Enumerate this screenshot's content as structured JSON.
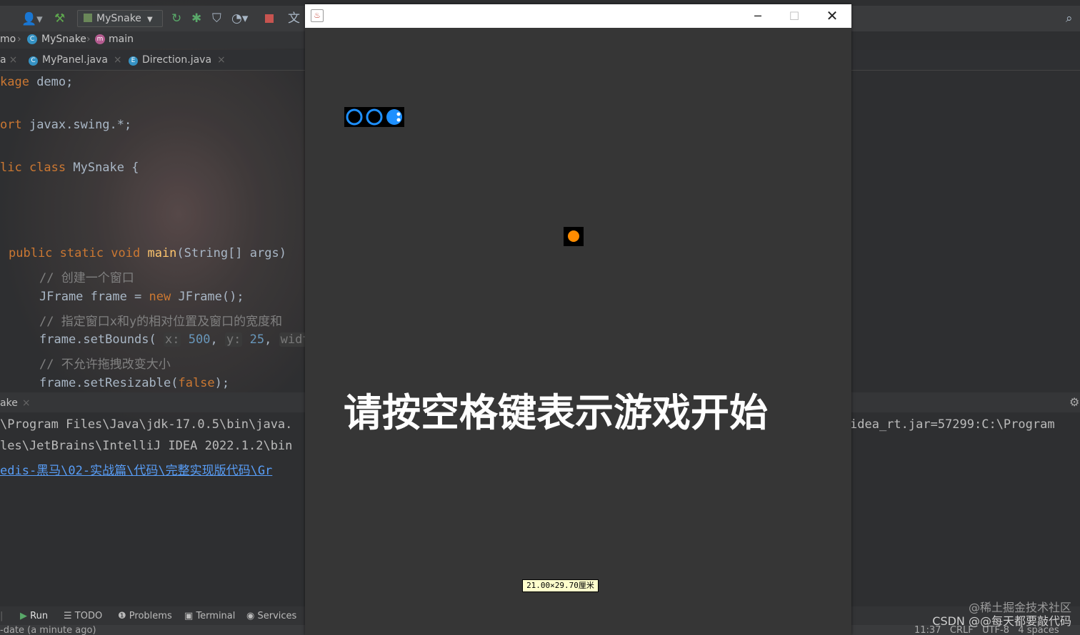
{
  "toolbar": {
    "run_config": "MySnake",
    "icons": [
      "user-icon",
      "build-hammer-icon",
      "rerun-icon",
      "debug-icon",
      "coverage-icon",
      "profile-icon",
      "stop-icon",
      "translate-icon",
      "search-icon"
    ]
  },
  "breadcrumb": {
    "parts": [
      "mo",
      "MySnake",
      "main"
    ]
  },
  "tabs": {
    "first_partial": "a",
    "items": [
      {
        "label": "MyPanel.java",
        "badge": "C"
      },
      {
        "label": "Direction.java",
        "badge": "E"
      }
    ]
  },
  "editor": {
    "line1_kw": "kage",
    "line1_rest": " demo;",
    "line2_kw": "ort",
    "line2_rest": " javax.swing.*;",
    "line3_kw": "lic class",
    "line3_rest": " MySnake {",
    "line4_public": "public static void ",
    "line4_fn": "main",
    "line4_rest": "(String[] args)",
    "comment1": "// 创建一个窗口",
    "line5_a": "JFrame frame = ",
    "line5_kw": "new",
    "line5_b": " JFrame();",
    "comment2": "// 指定窗口x和y的相对位置及窗口的宽度和",
    "line6_a": "frame.setBounds( ",
    "line6_hint_x": "x:",
    "line6_x": "500",
    "line6_hint_y": "y:",
    "line6_y": "25",
    "line6_hint_w": "widt",
    "comment3": "// 不允许拖拽改变大小",
    "line7_a": "frame.setResizable(",
    "line7_kw": "false",
    "line7_b": ");"
  },
  "run_panel": {
    "tab_label": "ake",
    "console_lines": [
      "\\Program Files\\Java\\jdk-17.0.5\\bin\\java.",
      "les\\JetBrains\\IntelliJ IDEA 2022.1.2\\bin",
      "edis-黑马\\02-实战篇\\代码\\完整实现版代码\\Gr"
    ],
    "console_right": "idea_rt.jar=57299:C:\\Program"
  },
  "bottom_tools": [
    {
      "label": "Run",
      "icon": "play-icon"
    },
    {
      "label": "TODO",
      "icon": "list-icon"
    },
    {
      "label": "Problems",
      "icon": "info-icon"
    },
    {
      "label": "Terminal",
      "icon": "terminal-icon"
    },
    {
      "label": "Services",
      "icon": "services-icon"
    }
  ],
  "status": {
    "left": "-date (a minute ago)",
    "right": "11:37   CRLF   UTF-8   4 spaces"
  },
  "game": {
    "start_message": "请按空格键表示游戏开始",
    "paper_size_label": "21.00×29.70厘米",
    "snake_color": "#1e90ff",
    "food_color": "#ff8c00"
  },
  "watermark": {
    "line1": "@稀土掘金技术社区",
    "line2": "CSDN @@每天都要敲代码"
  }
}
